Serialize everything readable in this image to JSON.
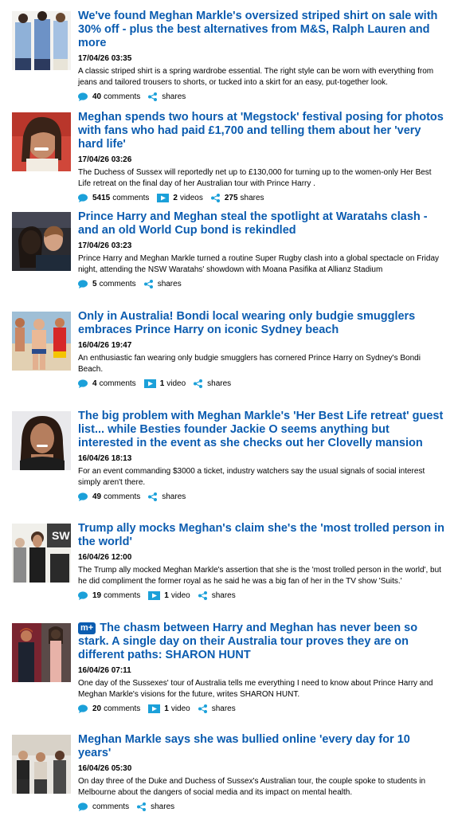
{
  "articles": [
    {
      "title": "We've found Meghan Markle's oversized striped shirt on sale with 30% off - plus the best alternatives from M&S, Ralph Lauren and more",
      "date": "17/04/26 03:35",
      "summary": "A classic striped shirt is a spring wardrobe essential. The right style can be worn with everything from jeans and tailored trousers to shorts, or tucked into a skirt for an easy, put-together look.",
      "comments": "40",
      "comments_label": "comments",
      "shares_label": "shares"
    },
    {
      "title": "Meghan spends two hours at 'Megstock' festival posing for photos with fans who had paid £1,700 and telling them about her 'very hard life'",
      "date": "17/04/26 03:26",
      "summary": "The Duchess of Sussex will reportedly net up to £130,000 for turning up to the women-only Her Best Life retreat on the final day of her Australian tour with Prince Harry .",
      "comments": "5415",
      "comments_label": "comments",
      "videos": "2",
      "videos_label": "videos",
      "shares": "275",
      "shares_label": "shares"
    },
    {
      "title": "Prince Harry and Meghan steal the spotlight at Waratahs clash - and an old World Cup bond is rekindled",
      "date": "17/04/26 03:23",
      "summary": "Prince Harry and Meghan Markle turned a routine Super Rugby clash into a global spectacle on Friday night, attending the NSW Waratahs' showdown with Moana Pasifika at Allianz Stadium",
      "comments": "5",
      "comments_label": "comments",
      "shares_label": "shares"
    },
    {
      "title": "Only in Australia! Bondi local wearing only budgie smugglers embraces Prince Harry on iconic Sydney beach",
      "date": "16/04/26 19:47",
      "summary": "An enthusiastic fan wearing only budgie smugglers has cornered Prince Harry on Sydney's Bondi Beach.",
      "comments": "4",
      "comments_label": "comments",
      "videos": "1",
      "videos_label": "video",
      "shares_label": "shares"
    },
    {
      "title": "The big problem with Meghan Markle's 'Her Best Life retreat' guest list... while Besties founder Jackie O seems anything but interested in the event as she checks out her Clovelly mansion",
      "date": "16/04/26 18:13",
      "summary": "For an event commanding $3000 a ticket, industry watchers say the usual signals of social interest simply aren't there.",
      "comments": "49",
      "comments_label": "comments",
      "shares_label": "shares"
    },
    {
      "title": "Trump ally mocks Meghan's claim she's the 'most trolled person in the world'",
      "date": "16/04/26 12:00",
      "summary": "The Trump ally mocked Meghan Markle's assertion that she is the 'most trolled person in the world', but he did compliment the former royal as he said he was a big fan of her in the TV show 'Suits.'",
      "comments": "19",
      "comments_label": "comments",
      "videos": "1",
      "videos_label": "video",
      "shares_label": "shares"
    },
    {
      "plus_badge": "m+",
      "title": "The chasm between Harry and Meghan has never been so stark. A single day on their Australia tour proves they are on different paths: SHARON HUNT",
      "date": "16/04/26 07:11",
      "summary": "One day of the Sussexes' tour of Australia tells me everything I need to know about Prince Harry and Meghan Markle's visions for the future, writes SHARON HUNT.",
      "comments": "20",
      "comments_label": "comments",
      "videos": "1",
      "videos_label": "video",
      "shares_label": "shares"
    },
    {
      "title": "Meghan Markle says she was bullied online 'every day for 10 years'",
      "date": "16/04/26 05:30",
      "summary": "On day three of the Duke and Duchess of Sussex's Australian tour, the couple spoke to students in Melbourne about the dangers of social media and its impact on mental health.",
      "comments_label": "comments",
      "shares_label": "shares"
    }
  ],
  "colors": {
    "headline": "#0b5cb0",
    "comment_icon": "#1ba0d9",
    "video_icon": "#1ba0d9",
    "share_icon": "#1ba0d9"
  }
}
